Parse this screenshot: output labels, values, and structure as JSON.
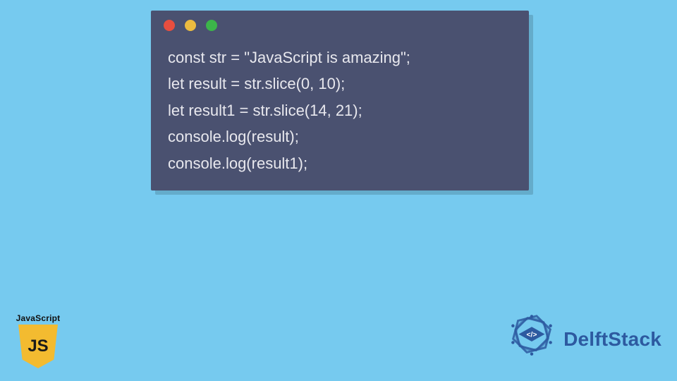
{
  "code_window": {
    "dots": [
      "red",
      "yellow",
      "green"
    ],
    "lines": [
      "const str = \"JavaScript is amazing\";",
      "let result = str.slice(0, 10);",
      "let result1 = str.slice(14, 21);",
      "console.log(result);",
      "console.log(result1);"
    ]
  },
  "js_badge": {
    "label": "JavaScript",
    "shield_text": "JS"
  },
  "brand": {
    "name": "DelftStack",
    "inner_glyph": "</>",
    "color": "#2d5aa0"
  },
  "colors": {
    "background": "#76caef",
    "window_bg": "#4a5170",
    "code_text": "#e8e8ee",
    "dot_red": "#e84e3f",
    "dot_yellow": "#ebbb40",
    "dot_green": "#3cb54a",
    "js_yellow": "#f3bb30"
  }
}
